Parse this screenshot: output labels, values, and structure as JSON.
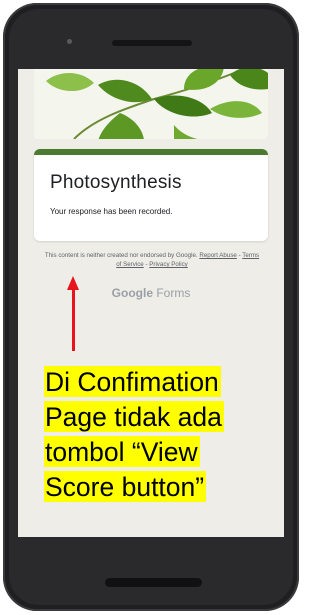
{
  "form": {
    "title": "Photosynthesis",
    "confirmation_message": "Your response has been recorded.",
    "accent_color": "#4c7a2f"
  },
  "footer": {
    "disclaimer_prefix": "This content is neither created nor endorsed by Google.",
    "report_link": "Report Abuse",
    "separator": " - ",
    "terms_link": "Terms of Service",
    "privacy_link": "Privacy Policy",
    "brand_google": "Google",
    "brand_forms": "Forms"
  },
  "annotation": {
    "lines": [
      "Di Confimation",
      "Page tidak ada",
      "tombol “View",
      "Score button”"
    ],
    "highlight_color": "#ffff00",
    "arrow_color": "#e8131b"
  }
}
